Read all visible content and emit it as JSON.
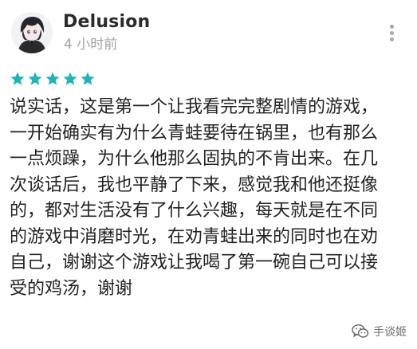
{
  "review": {
    "author": "Delusion",
    "time": "4 小时前",
    "rating": 5,
    "text": "说实话，这是第一个让我看完完整剧情的游戏，\n一开始确实有为什么青蛙要待在锅里，也有那么\n一点烦躁，为什么他那么固执的不肯出来。在几\n次谈话后，我也平静了下来，感觉我和他还挺像\n的，都对生活没有了什么兴趣，每天就是在不同\n的游戏中消磨时光，在劝青蛙出来的同时也在劝\n自己，谢谢这个游戏让我喝了第一碗自己可以接\n受的鸡汤，谢谢"
  },
  "icons": {
    "avatar": "anime-avatar",
    "more": "vertical-dots-icon",
    "star": "star-icon",
    "watermark": "wechat-icon"
  },
  "colors": {
    "star": "#21b4b6",
    "text": "#232323",
    "muted": "#a2a2a2"
  },
  "watermark": {
    "text": "手谈姬"
  }
}
